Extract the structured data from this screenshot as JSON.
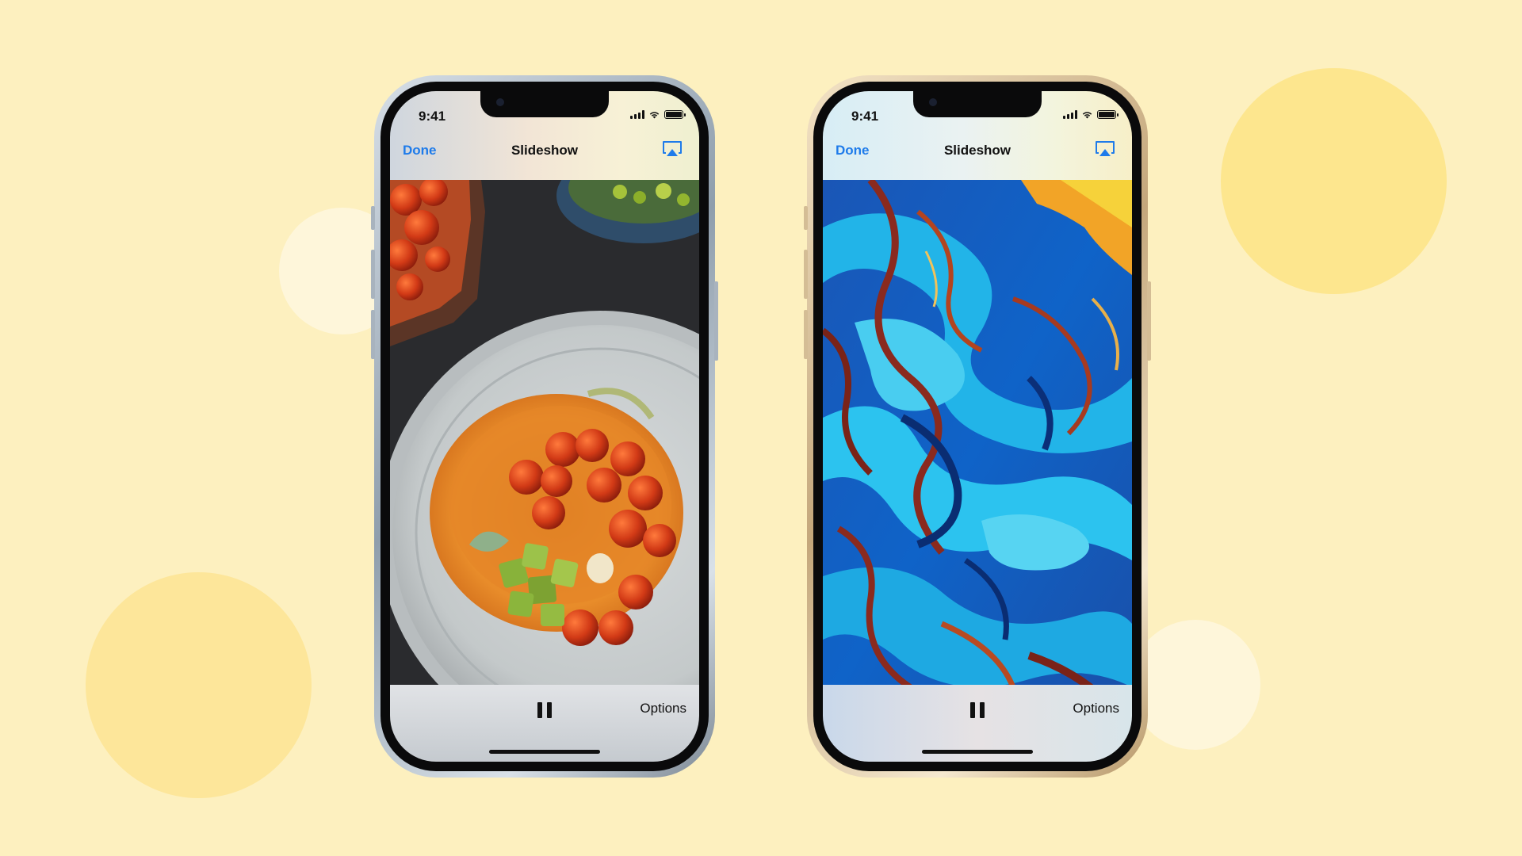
{
  "phones": [
    {
      "status": {
        "time": "9:41"
      },
      "nav": {
        "done_label": "Done",
        "title": "Slideshow"
      },
      "photo": "food-plate-with-roasted-tomatoes",
      "toolbar": {
        "options_label": "Options"
      },
      "icons": [
        "airplay-icon",
        "pause-icon",
        "signal-icon",
        "wifi-icon",
        "battery-icon"
      ]
    },
    {
      "status": {
        "time": "9:41"
      },
      "nav": {
        "done_label": "Done",
        "title": "Slideshow"
      },
      "photo": "blue-marbled-fluid-art",
      "toolbar": {
        "options_label": "Options"
      },
      "icons": [
        "airplay-icon",
        "pause-icon",
        "signal-icon",
        "wifi-icon",
        "battery-icon"
      ]
    }
  ],
  "colors": {
    "background": "#fdf0bf",
    "accent": "#1e7bea"
  }
}
